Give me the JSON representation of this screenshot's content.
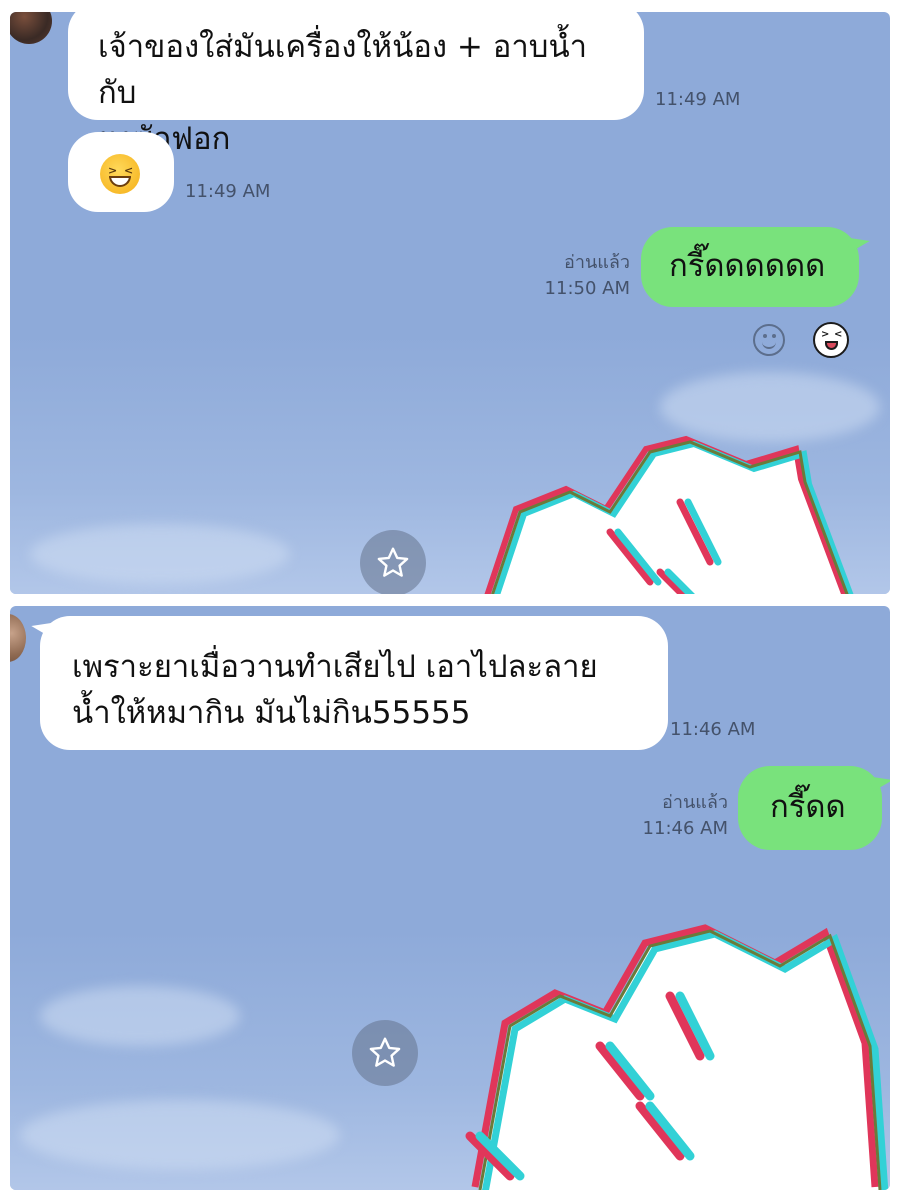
{
  "top_panel": {
    "messages": [
      {
        "from": "other",
        "text_line1": "เจ้าของใส่มันเครื่องให้น้อง + อาบน้ำกับ",
        "text_line2": "ผงซักฟอก",
        "time": "11:49 AM"
      },
      {
        "from": "other",
        "emoji": "grinning-squinting-face",
        "time": "11:49 AM"
      },
      {
        "from": "me",
        "text": "กรี๊ดดดดดด",
        "read_label": "อ่านแล้ว",
        "time": "11:50 AM"
      }
    ],
    "reactions": [
      "smile-react-icon",
      "laughing-sticker-icon"
    ]
  },
  "bottom_panel": {
    "messages": [
      {
        "from": "other",
        "text_line1": "เพราะยาเมื่อวานทำเสียไป เอาไปละลาย",
        "text_line2": "น้ำให้หมากิน มันไม่กิน55555",
        "time": "11:46 AM"
      },
      {
        "from": "me",
        "text": "กรี๊ดด",
        "read_label": "อ่านแล้ว",
        "time": "11:46 AM"
      }
    ]
  },
  "icons": {
    "favorite": "star-icon",
    "sticker": "white-cat-sticker"
  },
  "colors": {
    "chat_background": "#8eaad9",
    "incoming_bubble": "#ffffff",
    "outgoing_bubble": "#79e27c",
    "timestamp_text": "#44526b"
  }
}
